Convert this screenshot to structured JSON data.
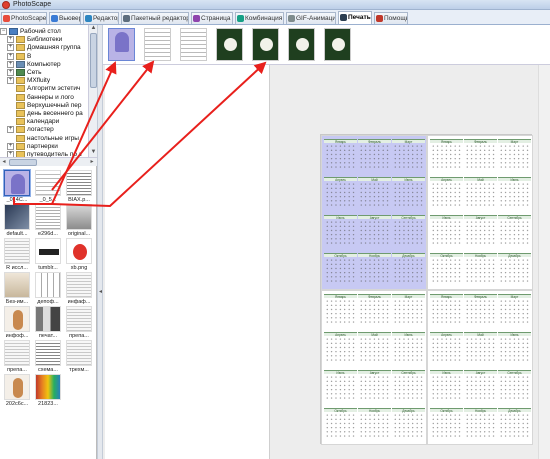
{
  "window": {
    "title": "PhotoScape"
  },
  "tabs": [
    {
      "label": "PhotoScape",
      "color": "#e74c3c",
      "active": false
    },
    {
      "label": "Вьювер",
      "color": "#3a7bd5",
      "active": false
    },
    {
      "label": "Редактор",
      "color": "#2e86c1",
      "active": false
    },
    {
      "label": "Пакетный редактор",
      "color": "#5d6d7e",
      "active": false
    },
    {
      "label": "Страница",
      "color": "#8e44ad",
      "active": false
    },
    {
      "label": "Комбинация",
      "color": "#16a085",
      "active": false
    },
    {
      "label": "GIF-Анимация",
      "color": "#7f8c8d",
      "active": false
    },
    {
      "label": "Печать",
      "color": "#2c3e50",
      "active": true
    },
    {
      "label": "Помощь",
      "color": "#c0392b",
      "active": false
    }
  ],
  "tree": [
    {
      "label": "Рабочий стол",
      "icon": "desktop-icon",
      "expander": "−"
    },
    {
      "label": "Библиотеки",
      "icon": "folder-icon",
      "expander": "+"
    },
    {
      "label": "Домашняя группа",
      "icon": "folder-icon",
      "expander": "+"
    },
    {
      "label": "В",
      "icon": "folder-icon",
      "expander": "+"
    },
    {
      "label": "Компьютер",
      "icon": "computer-icon",
      "expander": "+"
    },
    {
      "label": "Сеть",
      "icon": "network-icon",
      "expander": "+"
    },
    {
      "label": "MXfluity",
      "icon": "folder-icon",
      "expander": "+"
    },
    {
      "label": "Алгоритм эстетич",
      "icon": "folder-icon",
      "expander": ""
    },
    {
      "label": "баннеры и лого",
      "icon": "folder-icon",
      "expander": ""
    },
    {
      "label": "Верхушечный пер",
      "icon": "folder-icon",
      "expander": ""
    },
    {
      "label": "день весеннего ра",
      "icon": "folder-icon",
      "expander": ""
    },
    {
      "label": "календари",
      "icon": "folder-icon",
      "expander": ""
    },
    {
      "label": "логастер",
      "icon": "folder-icon",
      "expander": "+"
    },
    {
      "label": "настольные игры",
      "icon": "folder-icon",
      "expander": ""
    },
    {
      "label": "партнерки",
      "icon": "folder-icon",
      "expander": "+"
    },
    {
      "label": "путеводитель по з",
      "icon": "folder-icon",
      "expander": "+"
    }
  ],
  "thumbnails": [
    {
      "caption": "_0_4C...",
      "kind": "lavender",
      "selected": true
    },
    {
      "caption": "_0_5...",
      "kind": "calendar",
      "selected": false
    },
    {
      "caption": "BIAX.p...",
      "kind": "lines",
      "selected": false
    },
    {
      "caption": "default...",
      "kind": "dark",
      "selected": false
    },
    {
      "caption": "e296d...",
      "kind": "text",
      "selected": false
    },
    {
      "caption": "original...",
      "kind": "gray",
      "selected": false
    },
    {
      "caption": "R иссл...",
      "kind": "doc",
      "selected": false
    },
    {
      "caption": "tumblr...",
      "kind": "logo",
      "selected": false
    },
    {
      "caption": "xb.png",
      "kind": "red",
      "selected": false
    },
    {
      "caption": "Без-им...",
      "kind": "photo",
      "selected": false
    },
    {
      "caption": "депоф...",
      "kind": "table",
      "selected": false
    },
    {
      "caption": "инфаф...",
      "kind": "doc",
      "selected": false
    },
    {
      "caption": "инфоф...",
      "kind": "figure",
      "selected": false
    },
    {
      "caption": "печат...",
      "kind": "bars",
      "selected": false
    },
    {
      "caption": "препа...",
      "kind": "doc",
      "selected": false
    },
    {
      "caption": "препа...",
      "kind": "doc",
      "selected": false
    },
    {
      "caption": "схема...",
      "kind": "lines",
      "selected": false
    },
    {
      "caption": "трехм...",
      "kind": "doc",
      "selected": false
    },
    {
      "caption": "202c6c...",
      "kind": "figure",
      "selected": false
    },
    {
      "caption": "21823...",
      "kind": "spectrum",
      "selected": false
    }
  ],
  "strip": [
    {
      "kind": "lavender"
    },
    {
      "kind": "calendar"
    },
    {
      "kind": "calendar"
    },
    {
      "kind": "flower"
    },
    {
      "kind": "flower"
    },
    {
      "kind": "flower"
    },
    {
      "kind": "flower"
    }
  ],
  "calendar_months": [
    "Январь",
    "Февраль",
    "Март",
    "Апрель",
    "Май",
    "Июнь",
    "Июль",
    "Август",
    "Сентябрь",
    "Октябрь",
    "Ноябрь",
    "Декабрь"
  ],
  "colors": {
    "arrow": "#e8201c",
    "accent": "#3160b8",
    "highlight": "#c7c9f3"
  },
  "icons": {
    "splitter_grip": "◂",
    "scroll_up": "▲",
    "scroll_down": "▼",
    "scroll_left": "◂",
    "scroll_right": "▸"
  }
}
